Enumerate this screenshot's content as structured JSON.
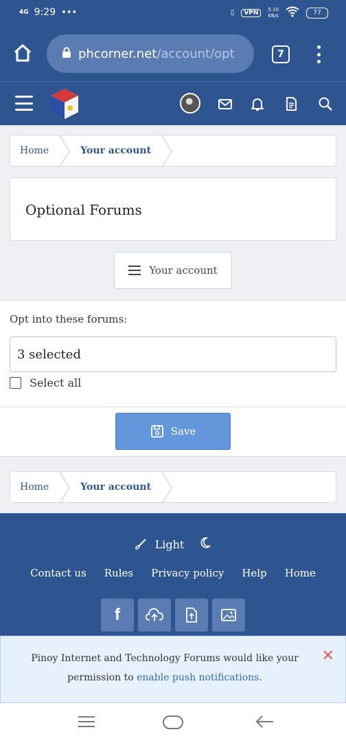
{
  "status_bar": {
    "network": "4G",
    "time": "9:29",
    "dots": "•••",
    "vpn": "VPN",
    "speed": "5.10\nKB/s",
    "battery": "77"
  },
  "browser": {
    "url_main": "phcorner.net",
    "url_rest": "/account/opt",
    "tab_count": "7"
  },
  "breadcrumb": {
    "home": "Home",
    "current": "Your account"
  },
  "page": {
    "title": "Optional Forums"
  },
  "account_button": {
    "label": "Your account"
  },
  "form": {
    "label": "Opt into these forums:",
    "select_value": "3 selected",
    "select_all": "Select all"
  },
  "save_button": {
    "label": "Save"
  },
  "footer": {
    "theme_light": "Light",
    "links": [
      "Contact us",
      "Rules",
      "Privacy policy",
      "Help",
      "Home"
    ]
  },
  "notice": {
    "text": "Pinoy Internet and Technology Forums would like your permission to",
    "link": "enable push notifications",
    "end": "."
  },
  "colors": {
    "brand": "#2f5590",
    "save": "#6496dc"
  }
}
